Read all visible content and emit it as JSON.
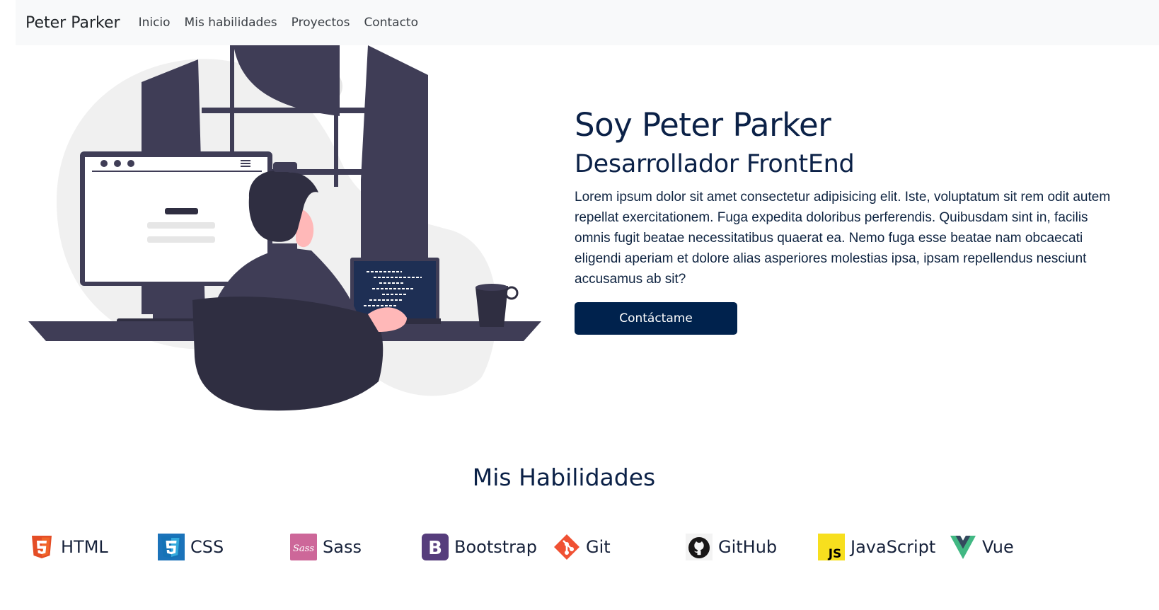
{
  "nav": {
    "brand": "Peter Parker",
    "links": [
      "Inicio",
      "Mis habilidades",
      "Proyectos",
      "Contacto"
    ]
  },
  "hero": {
    "title": "Soy Peter Parker",
    "subtitle": "Desarrollador FrontEnd",
    "description": "Lorem ipsum dolor sit amet consectetur adipisicing elit. Iste, voluptatum sit rem odit autem repellat exercitationem. Fuga expedita doloribus perferendis. Quibusdam sint in, facilis omnis fugit beatae necessitatibus quaerat ea. Nemo fuga esse beatae nam obcaecati eligendi aperiam et dolore alias asperiores molestias ipsa, ipsam repellendus nesciunt accusamus ab sit?",
    "cta_label": "Contáctame"
  },
  "skills": {
    "title": "Mis Habilidades",
    "items": [
      {
        "label": "HTML",
        "icon": "html5-icon"
      },
      {
        "label": "CSS",
        "icon": "css3-icon"
      },
      {
        "label": "Sass",
        "icon": "sass-icon"
      },
      {
        "label": "Bootstrap",
        "icon": "bootstrap-icon"
      },
      {
        "label": "Git",
        "icon": "git-icon"
      },
      {
        "label": "GitHub",
        "icon": "github-icon"
      },
      {
        "label": "JavaScript",
        "icon": "javascript-icon"
      },
      {
        "label": "Vue",
        "icon": "vue-icon"
      }
    ]
  },
  "colors": {
    "primary": "#00224d",
    "navbar_bg": "#f8f9fa",
    "illustration_dark": "#3f3d56"
  }
}
